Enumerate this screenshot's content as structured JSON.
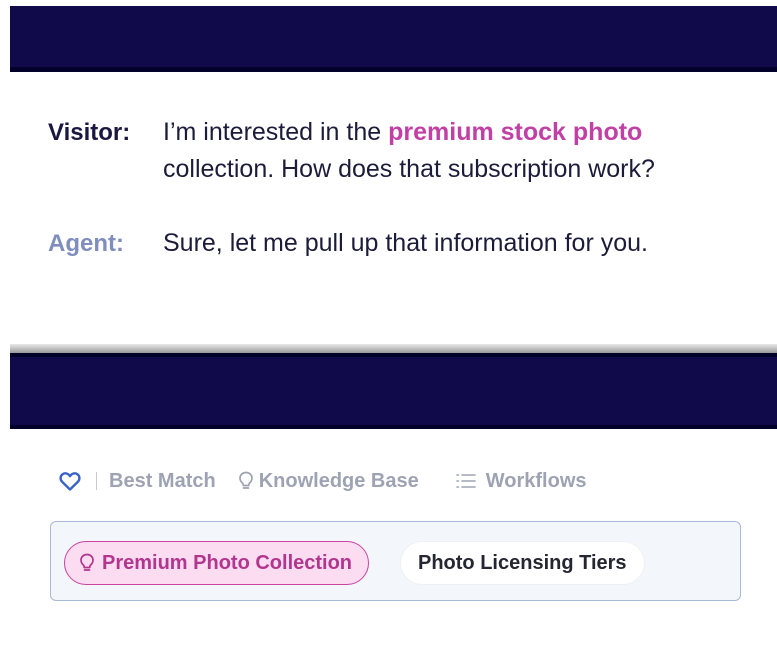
{
  "conversation": {
    "visitor": {
      "speaker": "Visitor:",
      "line1_before": "I’m interested in the ",
      "line1_highlight": "premium stock photo",
      "line2": "collection. How does that subscription work?"
    },
    "agent": {
      "speaker": "Agent:",
      "text": "Sure, let me pull up that information for you."
    }
  },
  "toolbar": {
    "favorite_icon": "heart-outline-icon",
    "best_match": "Best Match",
    "knowledge_base_icon": "lightbulb-icon",
    "knowledge_base": "Knowledge Base",
    "workflows_icon": "list-icon",
    "workflows": "Workflows"
  },
  "results": {
    "chips": [
      {
        "label": "Premium Photo Collection",
        "icon": "lightbulb-icon",
        "selected": true
      },
      {
        "label": "Photo Licensing Tiers",
        "selected": false
      }
    ]
  },
  "colors": {
    "header_band": "#110a4a",
    "highlight": "#c140a6",
    "agent_label": "#7f8dbf",
    "toolbar_text": "#9ea3b3",
    "chip_selected_bg": "#fbdcf1"
  }
}
